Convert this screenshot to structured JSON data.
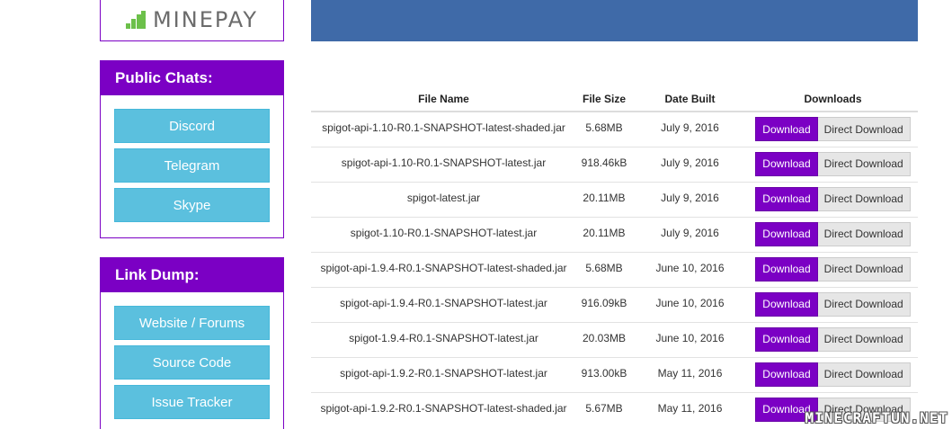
{
  "logo": {
    "text": "MINEPAY"
  },
  "public_chats": {
    "title": "Public Chats:",
    "buttons": [
      "Discord",
      "Telegram",
      "Skype"
    ]
  },
  "link_dump": {
    "title": "Link Dump:",
    "buttons": [
      "Website / Forums",
      "Source Code",
      "Issue Tracker"
    ]
  },
  "table": {
    "headers": {
      "file_name": "File Name",
      "file_size": "File Size",
      "date_built": "Date Built",
      "downloads": "Downloads"
    },
    "download_label": "Download",
    "direct_label": "Direct Download",
    "rows": [
      {
        "file": "spigot-api-1.10-R0.1-SNAPSHOT-latest-shaded.jar",
        "size": "5.68MB",
        "date": "July 9, 2016"
      },
      {
        "file": "spigot-api-1.10-R0.1-SNAPSHOT-latest.jar",
        "size": "918.46kB",
        "date": "July 9, 2016"
      },
      {
        "file": "spigot-latest.jar",
        "size": "20.11MB",
        "date": "July 9, 2016"
      },
      {
        "file": "spigot-1.10-R0.1-SNAPSHOT-latest.jar",
        "size": "20.11MB",
        "date": "July 9, 2016"
      },
      {
        "file": "spigot-api-1.9.4-R0.1-SNAPSHOT-latest-shaded.jar",
        "size": "5.68MB",
        "date": "June 10, 2016"
      },
      {
        "file": "spigot-api-1.9.4-R0.1-SNAPSHOT-latest.jar",
        "size": "916.09kB",
        "date": "June 10, 2016"
      },
      {
        "file": "spigot-1.9.4-R0.1-SNAPSHOT-latest.jar",
        "size": "20.03MB",
        "date": "June 10, 2016"
      },
      {
        "file": "spigot-api-1.9.2-R0.1-SNAPSHOT-latest.jar",
        "size": "913.00kB",
        "date": "May 11, 2016"
      },
      {
        "file": "spigot-api-1.9.2-R0.1-SNAPSHOT-latest-shaded.jar",
        "size": "5.67MB",
        "date": "May 11, 2016"
      }
    ]
  },
  "watermark": "MINECRAFTUN.NET",
  "colors": {
    "purple": "#7b00c4",
    "header_blue": "#3f6aa8",
    "sidebar_button": "#5bc0de",
    "logo_green": "#6cc04a"
  }
}
